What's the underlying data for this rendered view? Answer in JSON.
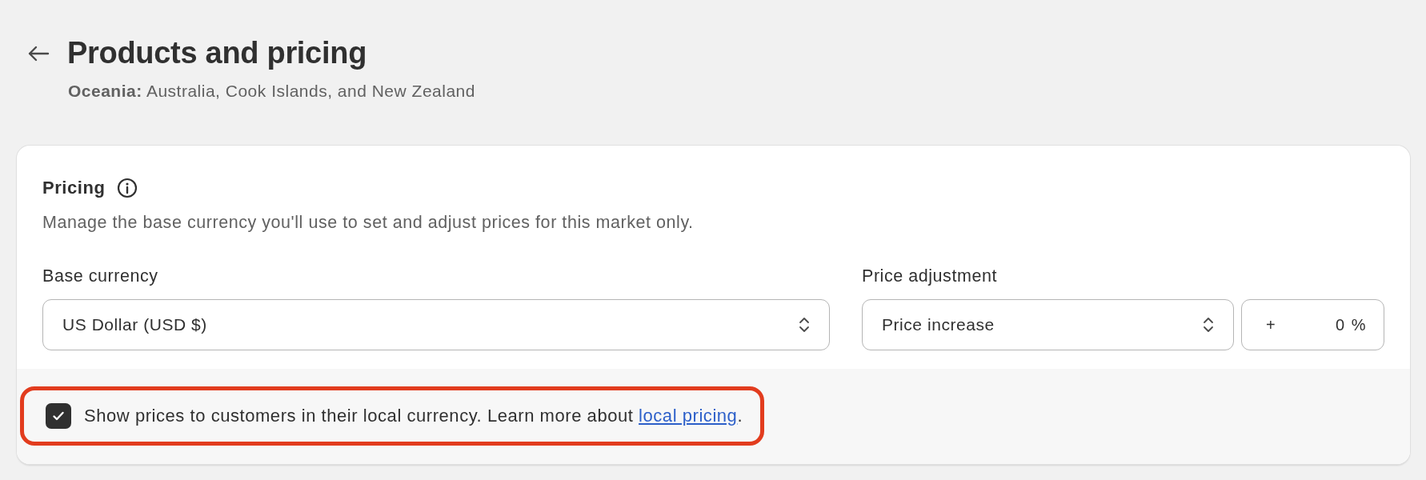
{
  "page": {
    "title": "Products and pricing",
    "subtitle": "**Oceania:** Australia, Cook Islands, and New Zealand"
  },
  "pricing": {
    "heading": "Pricing",
    "description": "Manage the base currency you'll use to set and adjust prices for this market only.",
    "base_currency": {
      "label": "Base currency",
      "value": "US Dollar (USD $)"
    },
    "price_adjustment": {
      "label": "Price adjustment",
      "value": "Price increase",
      "sign": "+",
      "amount": "0",
      "unit": "%"
    },
    "local_currency": {
      "checked": true,
      "text": "Show prices to customers in their local currency. Learn more about ",
      "link": "local pricing",
      "after": ".",
      "highlighted": true
    }
  }
}
